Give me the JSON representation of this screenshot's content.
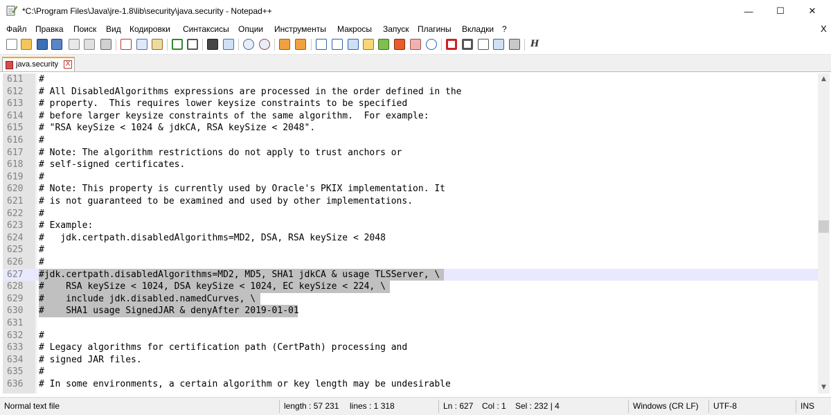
{
  "window": {
    "title": "*C:\\Program Files\\Java\\jre-1.8\\lib\\security\\java.security - Notepad++",
    "minimize_glyph": "—",
    "maximize_glyph": "☐",
    "close_glyph": "✕"
  },
  "menu": {
    "items": [
      "Файл",
      "Правка",
      "Поиск",
      "Вид",
      "Кодировки",
      "Синтаксисы",
      "Опции",
      "Инструменты",
      "Макросы",
      "Запуск",
      "Плагины",
      "Вкладки",
      "?"
    ],
    "close_glyph": "X"
  },
  "toolbar": {
    "icons": [
      "new-file-icon",
      "open-file-icon",
      "save-icon",
      "save-all-icon",
      "close-icon",
      "close-all-icon",
      "print-icon",
      "cut-icon",
      "copy-icon",
      "paste-icon",
      "undo-icon",
      "redo-icon",
      "find-icon",
      "replace-icon",
      "zoom-in-icon",
      "zoom-out-icon",
      "sync-vertical-icon",
      "sync-horizontal-icon",
      "word-wrap-icon",
      "show-all-chars-icon",
      "indent-guide-icon",
      "udl-icon",
      "doc-map-icon",
      "function-list-icon",
      "folder-workspace-icon",
      "monitoring-icon",
      "record-macro-icon",
      "stop-record-icon",
      "play-macro-icon",
      "run-macro-multiple-icon",
      "save-macro-icon",
      "hex-icon"
    ],
    "last_glyph": "H"
  },
  "tabs": [
    {
      "label": "java.security",
      "close_glyph": "X",
      "active": true
    }
  ],
  "editor": {
    "first_line": 611,
    "current_line": 627,
    "lines": [
      {
        "num": "611",
        "text": "#"
      },
      {
        "num": "612",
        "text": "# All DisabledAlgorithms expressions are processed in the order defined in the"
      },
      {
        "num": "613",
        "text": "# property.  This requires lower keysize constraints to be specified"
      },
      {
        "num": "614",
        "text": "# before larger keysize constraints of the same algorithm.  For example:"
      },
      {
        "num": "615",
        "text": "# \"RSA keySize < 1024 & jdkCA, RSA keySize < 2048\"."
      },
      {
        "num": "616",
        "text": "#"
      },
      {
        "num": "617",
        "text": "# Note: The algorithm restrictions do not apply to trust anchors or"
      },
      {
        "num": "618",
        "text": "# self-signed certificates."
      },
      {
        "num": "619",
        "text": "#"
      },
      {
        "num": "620",
        "text": "# Note: This property is currently used by Oracle's PKIX implementation. It"
      },
      {
        "num": "621",
        "text": "# is not guaranteed to be examined and used by other implementations."
      },
      {
        "num": "622",
        "text": "#"
      },
      {
        "num": "623",
        "text": "# Example:"
      },
      {
        "num": "624",
        "text": "#   jdk.certpath.disabledAlgorithms=MD2, DSA, RSA keySize < 2048"
      },
      {
        "num": "625",
        "text": "#"
      },
      {
        "num": "626",
        "text": "#"
      },
      {
        "num": "627",
        "text": "#jdk.certpath.disabledAlgorithms=MD2, MD5, SHA1 jdkCA & usage TLSServer, \\ "
      },
      {
        "num": "628",
        "text": "#    RSA keySize < 1024, DSA keySize < 1024, EC keySize < 224, \\ "
      },
      {
        "num": "629",
        "text": "#    include jdk.disabled.namedCurves, \\ "
      },
      {
        "num": "630",
        "text": "#    SHA1 usage SignedJAR & denyAfter 2019-01-01"
      },
      {
        "num": "631",
        "text": ""
      },
      {
        "num": "632",
        "text": "#"
      },
      {
        "num": "633",
        "text": "# Legacy algorithms for certification path (CertPath) processing and"
      },
      {
        "num": "634",
        "text": "# signed JAR files."
      },
      {
        "num": "635",
        "text": "#"
      },
      {
        "num": "636",
        "text": "# In some environments, a certain algorithm or key length may be undesirable"
      }
    ],
    "selection": {
      "from_line": 627,
      "to_line": 630,
      "selected_chars": 232
    }
  },
  "scrollbar": {
    "up_glyph": "▲",
    "down_glyph": "▼"
  },
  "status": {
    "type": "Normal text file",
    "length": "length : 57 231",
    "lines": "lines : 1 318",
    "ln": "Ln : 627",
    "col": "Col : 1",
    "sel": "Sel : 232 | 4",
    "eol": "Windows (CR LF)",
    "encoding": "UTF-8",
    "mode": "INS"
  },
  "colors": {
    "tab_accent": "#f5a321",
    "selection": "#c0c0c0",
    "current_line": "#e8e8ff",
    "gutter": "#e4e4e4",
    "line_number": "#808080"
  }
}
